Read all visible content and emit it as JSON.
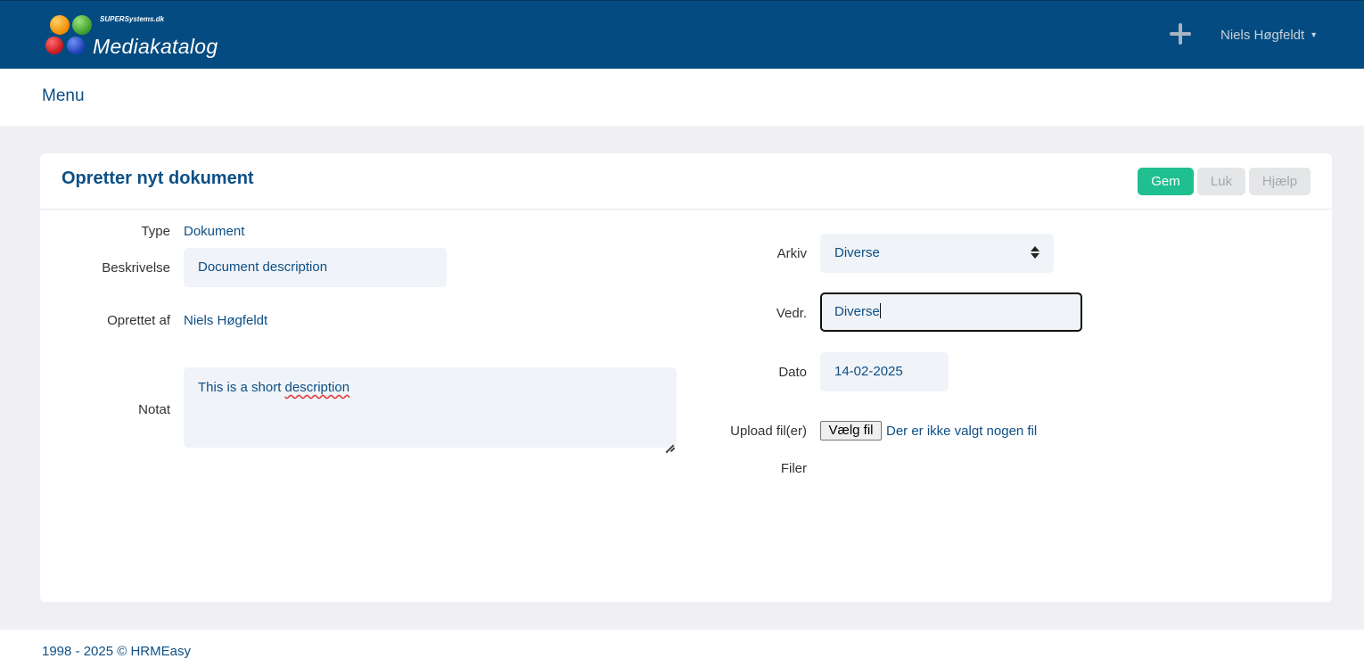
{
  "header": {
    "logo_tagline": "SUPERSystems.dk",
    "logo_name": "Mediakatalog",
    "user_name": "Niels Høgfeldt",
    "add_icon": "plus-icon",
    "caret_glyph": "▼"
  },
  "menu": {
    "label": "Menu"
  },
  "form": {
    "title": "Opretter nyt dokument",
    "buttons": {
      "save": "Gem",
      "close": "Luk",
      "help": "Hjælp"
    },
    "left": {
      "type_label": "Type",
      "type_value": "Dokument",
      "description_label": "Beskrivelse",
      "description_value": "Document description",
      "created_by_label": "Oprettet af",
      "created_by_value": "Niels Høgfeldt",
      "note_label": "Notat",
      "note_value_part1": "This is a short ",
      "note_value_part2": "description"
    },
    "right": {
      "archive_label": "Arkiv",
      "archive_value": "Diverse",
      "regarding_label": "Vedr.",
      "regarding_value": "Diverse",
      "date_label": "Dato",
      "date_value": "14-02-2025",
      "upload_label": "Upload fil(er)",
      "upload_button": "Vælg fil",
      "upload_status": "Der er ikke valgt nogen fil",
      "files_label": "Filer"
    }
  },
  "footer": {
    "copyright": "1998 - 2025 © HRMEasy"
  },
  "colors": {
    "header_bg": "#034b80",
    "accent_text": "#0d4f86",
    "save_button": "#1fbf8f",
    "page_bg": "#efeff4",
    "field_bg": "#f0f3f7"
  }
}
